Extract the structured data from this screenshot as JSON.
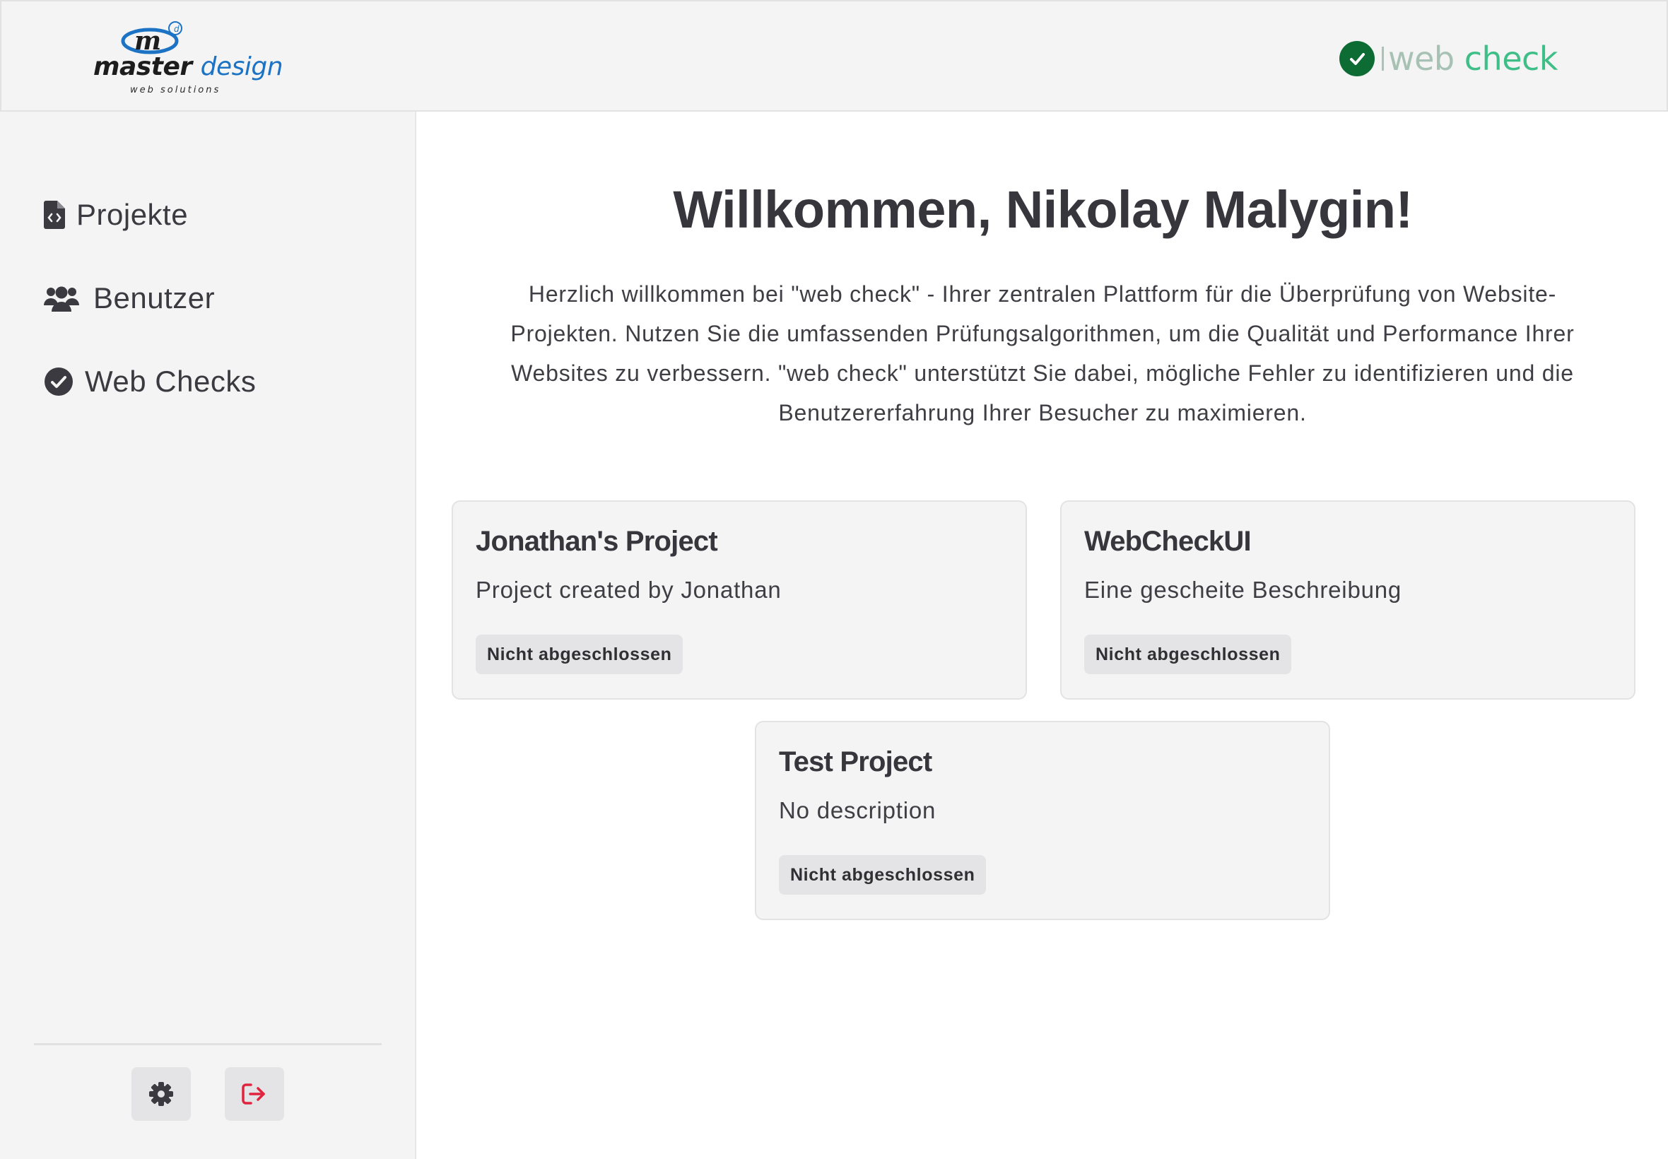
{
  "header": {
    "logo": {
      "mark_letters": "m",
      "word1": "master",
      "word2": "design",
      "subtitle": "web solutions"
    },
    "brand": {
      "word1": "web",
      "word2": "check",
      "icon": "check-circle-icon"
    }
  },
  "sidebar": {
    "items": [
      {
        "label": "Projekte",
        "icon": "file-code-icon"
      },
      {
        "label": "Benutzer",
        "icon": "users-icon"
      },
      {
        "label": "Web Checks",
        "icon": "check-circle-icon"
      }
    ],
    "buttons": [
      {
        "icon": "gear-icon"
      },
      {
        "icon": "logout-icon"
      }
    ]
  },
  "main": {
    "title": "Willkommen, Nikolay Malygin!",
    "intro": "Herzlich willkommen bei \"web check\" - Ihrer zentralen Plattform für die Überprüfung von Website-Projekten. Nutzen Sie die umfassenden Prüfungsalgorithmen, um die Qualität und Performance Ihrer Websites zu verbessern. \"web check\" unterstützt Sie dabei, mögliche Fehler zu identifizieren und die Benutzererfahrung Ihrer Besucher zu maximieren.",
    "projects": [
      {
        "title": "Jonathan's Project",
        "description": "Project created by Jonathan",
        "status": "Nicht abgeschlossen"
      },
      {
        "title": "WebCheckUI",
        "description": "Eine gescheite Beschreibung",
        "status": "Nicht abgeschlossen"
      },
      {
        "title": "Test Project",
        "description": "No description",
        "status": "Nicht abgeschlossen"
      }
    ]
  },
  "colors": {
    "header_bg": "#f4f4f4",
    "sidebar_bg": "#f4f4f4",
    "text_dark": "#3a3a40",
    "brand_green_dark": "#0d6b34",
    "brand_green": "#3fbf87",
    "brand_green_light": "#a7c2b5",
    "logo_blue": "#1c73c4",
    "logout_red": "#e0243f",
    "badge_bg": "#e4e4e7",
    "card_bg": "#f4f4f5"
  }
}
